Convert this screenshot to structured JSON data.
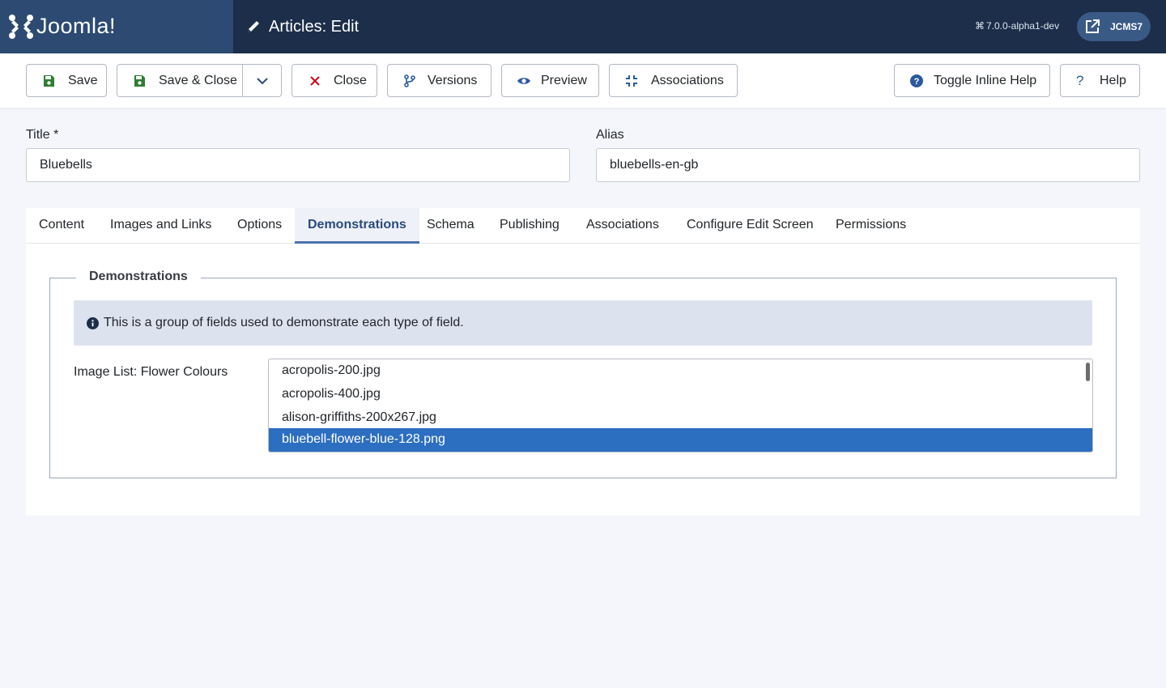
{
  "app": {
    "logo_text": "Joomla!",
    "page_title": "Articles: Edit",
    "version": "7.0.0-alpha1-dev",
    "user_site": "JCMS7"
  },
  "toolbar": {
    "save": "Save",
    "save_close": "Save & Close",
    "close": "Close",
    "versions": "Versions",
    "preview": "Preview",
    "associations": "Associations",
    "toggle_help": "Toggle Inline Help",
    "help": "Help"
  },
  "form": {
    "title_label": "Title *",
    "title_value": "Bluebells",
    "alias_label": "Alias",
    "alias_value": "bluebells-en-gb"
  },
  "tabs": [
    {
      "label": "Content"
    },
    {
      "label": "Images and Links"
    },
    {
      "label": "Options"
    },
    {
      "label": "Demonstrations",
      "active": true
    },
    {
      "label": "Schema"
    },
    {
      "label": "Publishing"
    },
    {
      "label": "Associations"
    },
    {
      "label": "Configure Edit Screen"
    },
    {
      "label": "Permissions"
    }
  ],
  "demonstrations": {
    "legend": "Demonstrations",
    "info": "This is a group of fields used to demonstrate each type of field.",
    "image_list_label": "Image List: Flower Colours",
    "options": [
      {
        "label": "acropolis-200.jpg",
        "selected": false
      },
      {
        "label": "acropolis-400.jpg",
        "selected": false
      },
      {
        "label": "alison-griffiths-200x267.jpg",
        "selected": false
      },
      {
        "label": "bluebell-flower-blue-128.png",
        "selected": true
      }
    ]
  },
  "colors": {
    "header_bg": "#1c2e4a",
    "logo_bg": "#2c4a72",
    "accent": "#2a4a7b",
    "selected_option": "#2c6ec0",
    "close_icon": "#d0021b"
  }
}
